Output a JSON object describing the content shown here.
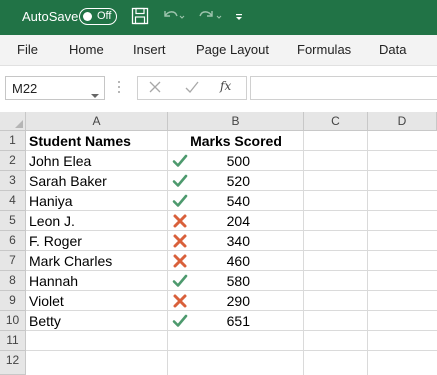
{
  "titlebar": {
    "autosave_label": "AutoSave",
    "autosave_state": "Off",
    "icons": [
      "save-icon",
      "undo-icon",
      "redo-icon",
      "customize-toolbar-icon"
    ]
  },
  "ribbon": {
    "tabs": [
      "File",
      "Home",
      "Insert",
      "Page Layout",
      "Formulas",
      "Data"
    ]
  },
  "formula_bar": {
    "name_box": "M22",
    "fx_label": "fx",
    "formula": ""
  },
  "grid": {
    "columns": [
      "A",
      "B",
      "C",
      "D"
    ],
    "rows": [
      "1",
      "2",
      "3",
      "4",
      "5",
      "6",
      "7",
      "8",
      "9",
      "10",
      "11",
      "12"
    ],
    "headers": {
      "a": "Student Names",
      "b": "Marks Scored"
    },
    "records": [
      {
        "name": "John Elea",
        "mark": "500",
        "status": "pass"
      },
      {
        "name": "Sarah Baker",
        "mark": "520",
        "status": "pass"
      },
      {
        "name": "Haniya",
        "mark": "540",
        "status": "pass"
      },
      {
        "name": "Leon J.",
        "mark": "204",
        "status": "fail"
      },
      {
        "name": "F. Roger",
        "mark": "340",
        "status": "fail"
      },
      {
        "name": "Mark Charles",
        "mark": "460",
        "status": "fail"
      },
      {
        "name": "Hannah",
        "mark": "580",
        "status": "pass"
      },
      {
        "name": "Violet",
        "mark": "290",
        "status": "fail"
      },
      {
        "name": "Betty",
        "mark": "651",
        "status": "pass"
      }
    ]
  },
  "colors": {
    "titlebar": "#217346",
    "check": "#4e9a6e",
    "cross": "#d9603b"
  }
}
